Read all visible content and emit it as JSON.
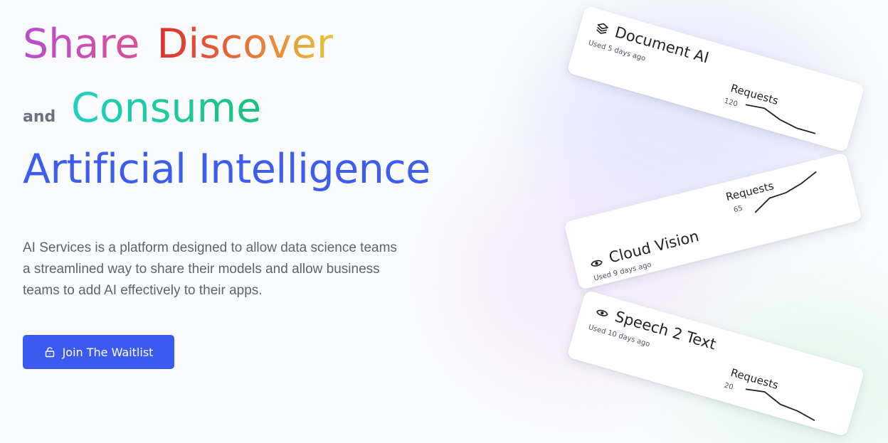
{
  "headline": {
    "word1": "Share",
    "word2": "Discover",
    "connector": "and",
    "word3": "Consume",
    "line3": "Artificial Intelligence"
  },
  "description": "AI Services is a platform designed to allow data science teams a streamlined way to share their models and allow business teams to add AI effectively to their apps.",
  "cta": {
    "label": "Join The Waitlist",
    "icon": "lock-open-icon",
    "color": "#3b5bf0"
  },
  "cards": [
    {
      "title": "Document AI",
      "icon": "layers-icon",
      "used": "Used 5 days ago",
      "requests_label": "Requests",
      "requests_value": "120",
      "trend": [
        0.7,
        0.8,
        0.4,
        0.2,
        0.2
      ]
    },
    {
      "title": "Cloud Vision",
      "icon": "eye-icon",
      "used": "Used 9 days ago",
      "requests_label": "Requests",
      "requests_value": "65",
      "trend": [
        0.05,
        0.45,
        0.5,
        0.7,
        1.0
      ]
    },
    {
      "title": "Speech 2 Text",
      "icon": "eye-icon",
      "used": "Used 10 days ago",
      "requests_label": "Requests",
      "requests_value": "20",
      "trend": [
        0.7,
        0.85,
        0.4,
        0.3,
        0.05
      ]
    }
  ]
}
